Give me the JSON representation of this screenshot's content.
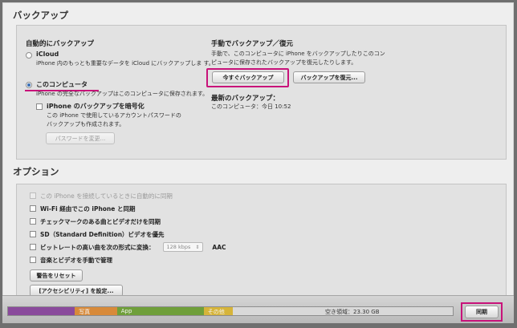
{
  "backup": {
    "title": "バックアップ",
    "auto": {
      "heading": "自動的にバックアップ",
      "icloud_label": "iCloud",
      "icloud_desc": "iPhone 内のもっとも重要なデータを iCloud にバックアップしま す。",
      "computer_label": "このコンピュータ",
      "computer_desc": "iPhone の完全なバックアップはこのコンピュータに保存されます。",
      "encrypt_label": "iPhone のバックアップを暗号化",
      "encrypt_desc_1": "この iPhone で使用しているアカウントパスワードの",
      "encrypt_desc_2": "バックアップも作成されます。",
      "change_password_button": "パスワードを変更..."
    },
    "manual": {
      "heading": "手動でバックアップ／復元",
      "desc_1": "手動で、このコンピュータに iPhone をバックアップしたりこのコン",
      "desc_2": "ピュータに保存されたバックアップを復元したりします。",
      "backup_now_button": "今すぐバックアップ",
      "restore_button": "バックアップを復元...",
      "latest_heading": "最新のバックアップ：",
      "latest_value": "このコンピュータ：今日 10:52"
    }
  },
  "options": {
    "title": "オプション",
    "items": [
      {
        "label": "この iPhone を接続しているときに自動的に同期",
        "enabled": false
      },
      {
        "label": "Wi-Fi 経由でこの iPhone と同期",
        "enabled": true
      },
      {
        "label": "チェックマークのある曲とビデオだけを同期",
        "enabled": true
      },
      {
        "label": "SD（Standard Definition）ビデオを優先",
        "enabled": true
      },
      {
        "label": "ビットレートの高い曲を次の形式に変換：",
        "enabled": true
      },
      {
        "label": "音楽とビデオを手動で管理",
        "enabled": true
      }
    ],
    "bitrate_select": "128 kbps",
    "format_label": "AAC",
    "reset_warnings_button": "警告をリセット",
    "accessibility_button": "[アクセシビリティ] を設定..."
  },
  "storage": {
    "segments": [
      {
        "label": "",
        "color": "#8a4a9c",
        "fraction": 0.15
      },
      {
        "label": "写真",
        "color": "#d88a3a",
        "fraction": 0.095
      },
      {
        "label": "App",
        "color": "#6f9f3a",
        "fraction": 0.195
      },
      {
        "label": "その他",
        "color": "#d6b43a",
        "fraction": 0.065
      }
    ],
    "free_label": "空き領域：23.30 GB",
    "sync_button": "同期"
  },
  "colors": {
    "highlight": "#c8137a"
  }
}
